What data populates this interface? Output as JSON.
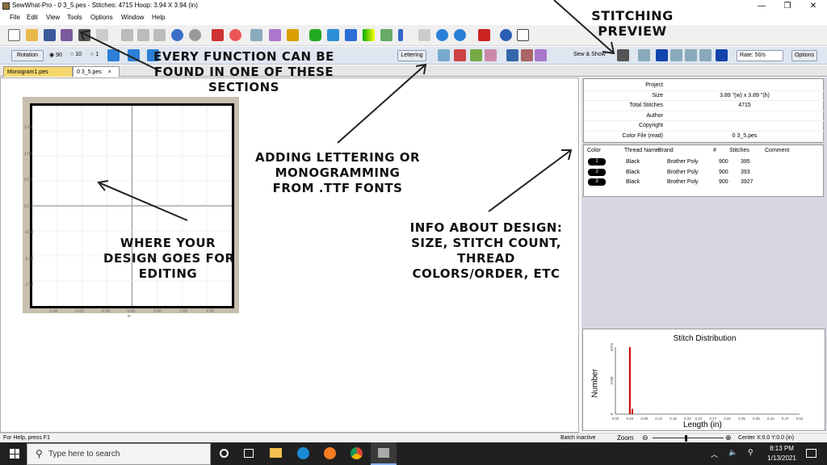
{
  "window": {
    "title": "SewWhat-Pro - 0 3_5.pes - Stitches: 4715  Hoop: 3.94 X 3.94 (in)",
    "minimize": "—",
    "maximize": "❐",
    "close": "✕"
  },
  "menu": [
    "File",
    "Edit",
    "View",
    "Tools",
    "Options",
    "Window",
    "Help"
  ],
  "toolbar2": {
    "rotation": "Rotation",
    "r90": "90",
    "r10": "10",
    "r1": "1",
    "lettering": "Lettering",
    "sewshow": "Sew & Show",
    "rate": "Rate:  50/s",
    "options": "Options"
  },
  "tabs": [
    "Monogram1.pes",
    "0 3_5.pes"
  ],
  "tab_close": "×",
  "canvas": {
    "y_ticks": [
      "1.50",
      "1.00",
      "0.50",
      "0.00",
      "-0.50",
      "-1.00",
      "-1.50"
    ],
    "x_ticks": [
      "-1.50",
      "-1.00",
      "-0.50",
      "0.00",
      "0.50",
      "1.00",
      "1.50"
    ],
    "x_unit": "in"
  },
  "properties": [
    {
      "label": "Project",
      "value": ""
    },
    {
      "label": "Size",
      "value": "3.89 \"(w) x 3.89 \"(h)"
    },
    {
      "label": "Total Stitches",
      "value": "4715"
    },
    {
      "label": "Author",
      "value": ""
    },
    {
      "label": "Copyright",
      "value": ""
    },
    {
      "label": "Color File (read)",
      "value": "0 3_5.pes"
    }
  ],
  "thread_headers": [
    "Color",
    "Thread Name",
    "Brand",
    "#",
    "Stitches",
    "Comment"
  ],
  "threads": [
    {
      "n": "1",
      "name": "Black",
      "brand": "Brother Poly",
      "num": "900",
      "stitches": "395"
    },
    {
      "n": "2",
      "name": "Black",
      "brand": "Brother Poly",
      "num": "900",
      "stitches": "393"
    },
    {
      "n": "3",
      "name": "Black",
      "brand": "Brother Poly",
      "num": "900",
      "stitches": "3927"
    }
  ],
  "chart_data": {
    "type": "bar",
    "title": "Stitch Distribution",
    "xlabel": "Length (in)",
    "ylabel": "Number",
    "x_ticks": [
      "0.00",
      "0.04",
      "0.08",
      "0.12",
      "0.16",
      "0.20",
      "0.23",
      "0.27",
      "0.31",
      "0.35",
      "0.39",
      "0.43",
      "0.47",
      "0.51"
    ],
    "y_ticks": [
      "4376",
      "2188",
      "0"
    ],
    "ylim": [
      0,
      4376
    ],
    "bars": [
      {
        "x": 0.04,
        "value": 4376
      },
      {
        "x": 0.047,
        "value": 350
      }
    ]
  },
  "status": {
    "help": "For Help, press F1",
    "batch": "Batch inactive",
    "zoom": "Zoom",
    "center": "Center X:0.0  Y:0.0 (in)"
  },
  "taskbar": {
    "search_placeholder": "Type here to search",
    "time": "8:13 PM",
    "date": "1/13/2021"
  },
  "annotations": {
    "stitching_preview": "STITCHING PREVIEW",
    "every_function": "EVERY FUNCTION CAN BE\nFOUND IN ONE OF THESE\nSECTIONS",
    "lettering": "ADDING LETTERING OR\nMONOGRAMMING\nFROM .TTF FONTS",
    "design": "WHERE YOUR\nDESIGN GOES FOR\nEDITING",
    "info": "INFO ABOUT DESIGN:\nSIZE, STITCH COUNT,\nTHREAD\nCOLORS/ORDER, ETC"
  }
}
